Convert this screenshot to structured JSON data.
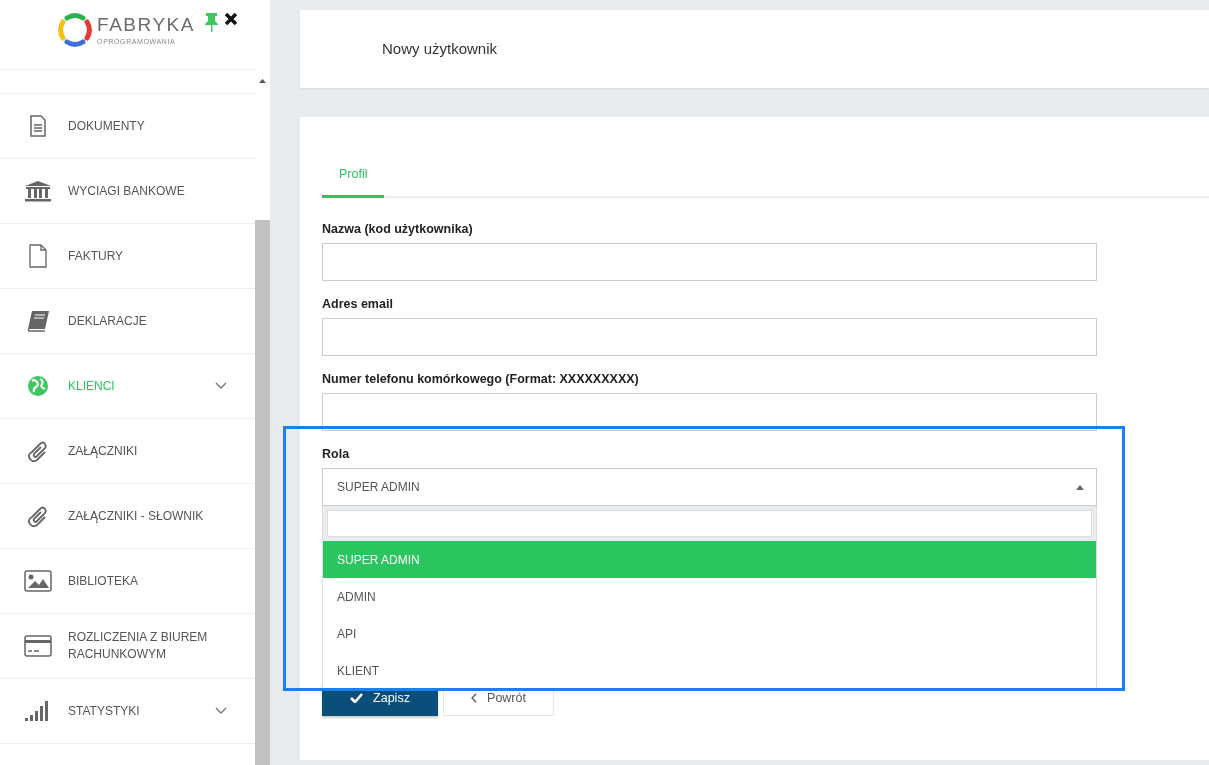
{
  "logo": {
    "name": "FABRYKA",
    "tagline": "OPROGRAMOWANIA"
  },
  "sidebar": {
    "items": [
      {
        "label": "DOKUMENTY",
        "active": false,
        "expandable": false
      },
      {
        "label": "WYCIAGI BANKOWE",
        "active": false,
        "expandable": false
      },
      {
        "label": "FAKTURY",
        "active": false,
        "expandable": false
      },
      {
        "label": "DEKLARACJE",
        "active": false,
        "expandable": false
      },
      {
        "label": "KLIENCI",
        "active": true,
        "expandable": true
      },
      {
        "label": "ZAŁĄCZNIKI",
        "active": false,
        "expandable": false
      },
      {
        "label": "ZAŁĄCZNIKI - SŁOWNIK",
        "active": false,
        "expandable": false
      },
      {
        "label": "BIBLIOTEKA",
        "active": false,
        "expandable": false
      },
      {
        "label": "ROZLICZENIA Z BIUREM RACHUNKOWYM",
        "active": false,
        "expandable": false
      },
      {
        "label": "STATYSTYKI",
        "active": false,
        "expandable": true
      }
    ]
  },
  "header": {
    "title": "Nowy użytkownik"
  },
  "tabs": [
    {
      "label": "Profil",
      "selected": true
    }
  ],
  "fields": [
    {
      "label": "Nazwa (kod użytkownika)"
    },
    {
      "label": "Adres email"
    },
    {
      "label": "Numer telefonu komórkowego (Format: XXXXXXXXX)"
    }
  ],
  "role": {
    "label": "Rola",
    "value": "SUPER ADMIN",
    "open": true,
    "options": [
      {
        "label": "SUPER ADMIN",
        "selected": true
      },
      {
        "label": "ADMIN",
        "selected": false
      },
      {
        "label": "API",
        "selected": false
      },
      {
        "label": "KLIENT",
        "selected": false
      }
    ]
  },
  "buttons": [
    {
      "kind": "primary",
      "label": "Zapisz"
    },
    {
      "kind": "back",
      "label": "Powrót"
    }
  ],
  "highlight": {
    "shown": true
  }
}
